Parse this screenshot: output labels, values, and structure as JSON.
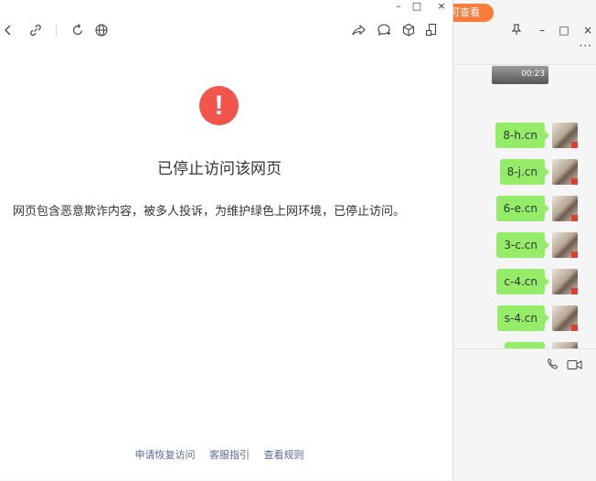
{
  "browser": {
    "window_controls": {
      "minimize": "–",
      "maximize": "□",
      "close": "×"
    },
    "toolbar": {
      "back_icon": "chevron-left-icon",
      "link_icon": "link-icon",
      "refresh_icon": "refresh-icon",
      "globe_icon": "globe-icon",
      "share_icon": "share-icon",
      "chat_icon": "chat-bubble-icon",
      "box_icon": "cube-icon",
      "window_icon": "window-icon"
    },
    "page": {
      "alert_glyph": "!",
      "title": "已停止访问该网页",
      "description": "网页包含恶意欺诈内容，被多人投诉，为维护绿色上网环境，已停止访问。",
      "footer_links": [
        "申请恢复访问",
        "客服指引",
        "查看规则"
      ]
    }
  },
  "chat": {
    "tab_label": "可查看",
    "controls": {
      "pin": "⊥",
      "minimize": "–",
      "maximize": "□",
      "close": "×",
      "more": "···"
    },
    "video_duration": "00:23",
    "messages": [
      "8-h.cn",
      "8-j.cn",
      "6-e.cn",
      "3-c.cn",
      "c-4.cn",
      "s-4.cn",
      ""
    ],
    "input_tools": [
      "phone-icon",
      "video-camera-icon"
    ]
  },
  "colors": {
    "alert_red": "#f1554c",
    "bubble_green": "#95ec69",
    "link_blue": "#566b95",
    "tab_orange": "#fa7d3c"
  }
}
